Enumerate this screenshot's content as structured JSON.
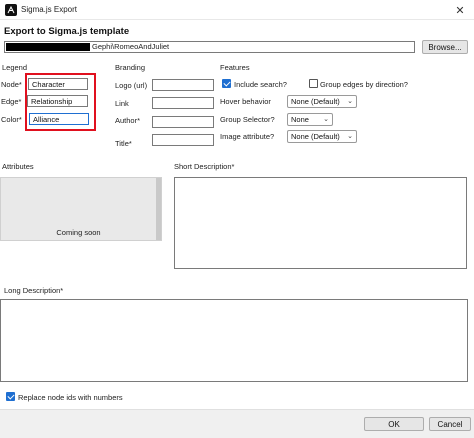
{
  "window": {
    "title": "Sigma.js Export",
    "close_glyph": "✕",
    "app_icon": "gephi-app-icon"
  },
  "dialog": {
    "heading": "Export to Sigma.js template",
    "path_value": "Gephi\\RomeoAndJuliet",
    "browse_label": "Browse..."
  },
  "legend": {
    "title": "Legend",
    "node_label": "Node*",
    "node_value": "Character",
    "edge_label": "Edge*",
    "edge_value": "Relationship",
    "color_label": "Color*",
    "color_value": "Alliance",
    "highlight_color": "#e0101e"
  },
  "branding": {
    "title": "Branding",
    "logo_label": "Logo (url)",
    "link_label": "Link",
    "author_label": "Author*",
    "title_label": "Title*",
    "logo_value": "",
    "link_value": "",
    "author_value": "",
    "title_value": ""
  },
  "features": {
    "title": "Features",
    "include_search_label": "Include search?",
    "include_search_checked": true,
    "group_edges_label": "Group edges by direction?",
    "group_edges_checked": false,
    "hover_label": "Hover behavior",
    "hover_value": "None (Default)",
    "group_selector_label": "Group Selector?",
    "group_selector_value": "None",
    "image_attr_label": "Image attribute?",
    "image_attr_value": "None (Default)",
    "chevron_glyph": "⌄"
  },
  "attributes": {
    "title": "Attributes",
    "placeholder": "Coming soon"
  },
  "short_description": {
    "title": "Short Description*",
    "value": ""
  },
  "long_description": {
    "title": "Long Description*",
    "value": ""
  },
  "options": {
    "replace_ids_label": "Replace node ids with numbers",
    "replace_ids_checked": true
  },
  "buttons": {
    "ok_label": "OK",
    "cancel_label": "Cancel"
  },
  "colors": {
    "accent": "#1f6fd1",
    "background": "#ffffff",
    "panel_gray": "#e9e9e9"
  }
}
